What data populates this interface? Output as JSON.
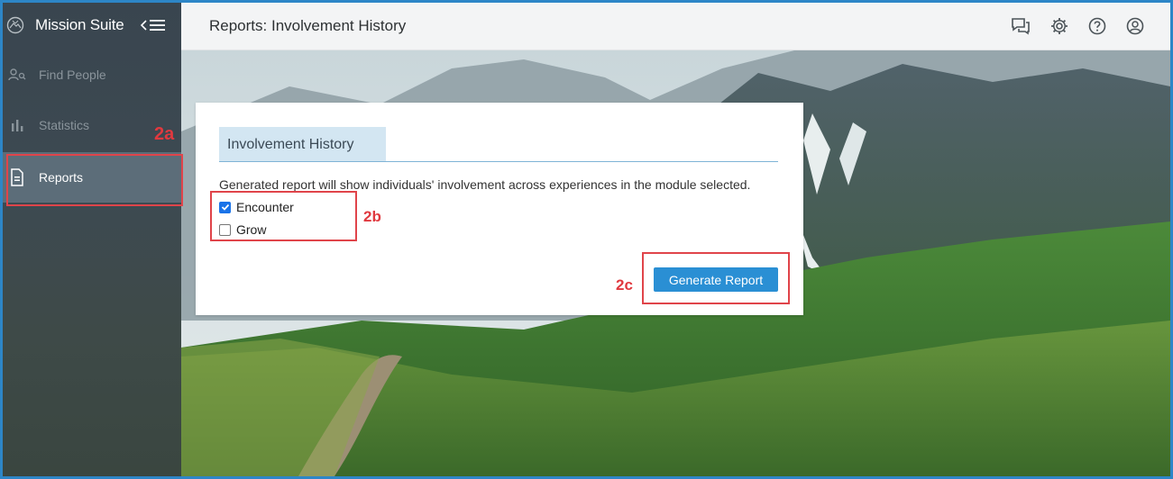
{
  "app": {
    "title": "Mission Suite"
  },
  "sidebar": {
    "items": [
      {
        "label": "Find People",
        "icon": "people-search-icon",
        "active": false
      },
      {
        "label": "Statistics",
        "icon": "bar-chart-icon",
        "active": false
      },
      {
        "label": "Reports",
        "icon": "document-icon",
        "active": true
      }
    ]
  },
  "header": {
    "title": "Reports: Involvement History",
    "icons": [
      "chat-icon",
      "gear-icon",
      "help-icon",
      "user-account-icon"
    ]
  },
  "card": {
    "tab_label": "Involvement History",
    "description": "Generated report will show individuals' involvement across experiences in the module selected.",
    "options": [
      {
        "label": "Encounter",
        "checked": true
      },
      {
        "label": "Grow",
        "checked": false
      }
    ],
    "generate_label": "Generate Report"
  },
  "annotations": {
    "a": "2a",
    "b": "2b",
    "c": "2c"
  },
  "colors": {
    "accent": "#2a8fd4",
    "sidebar_bg": "#3d4a52",
    "sidebar_active": "#5c6d79",
    "callout": "#e0444a",
    "frame": "#2d86c7"
  }
}
